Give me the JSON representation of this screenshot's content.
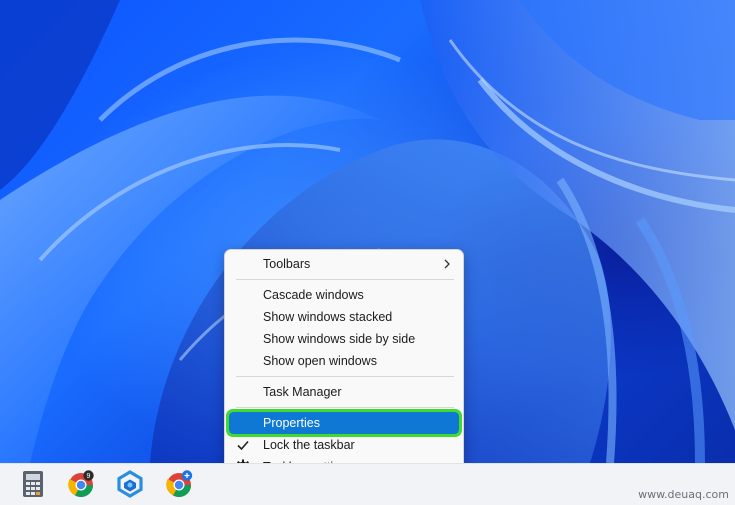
{
  "context_menu": {
    "toolbars": "Toolbars",
    "cascade": "Cascade windows",
    "stacked": "Show windows stacked",
    "side_by_side": "Show windows side by side",
    "open_windows": "Show open windows",
    "task_manager": "Task Manager",
    "properties": "Properties",
    "lock_taskbar": "Lock the taskbar",
    "taskbar_settings": "Taskbar settings"
  },
  "taskbar": {
    "icons": [
      "calculator-icon",
      "chrome-icon",
      "app-icon",
      "chrome-beta-icon"
    ],
    "chrome_badge": "9"
  },
  "watermark": "www.deuaq.com",
  "colors": {
    "highlight": "#0f78d4",
    "highlight_outline": "#3ddc2e",
    "wallpaper": "#0c54ff"
  }
}
